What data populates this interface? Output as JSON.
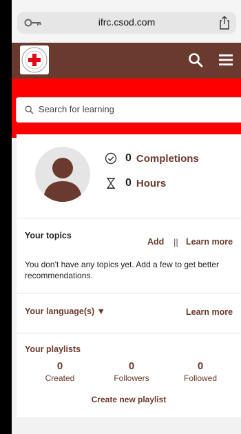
{
  "browser": {
    "url": "ifrc.csod.com"
  },
  "search": {
    "placeholder": "Search for learning"
  },
  "stats": {
    "completions": {
      "value": "0",
      "label": "Completions"
    },
    "hours": {
      "value": "0",
      "label": "Hours"
    }
  },
  "topics": {
    "title": "Your topics",
    "add_label": "Add",
    "separator": "||",
    "learn_more_label": "Learn more",
    "empty_text": "You don't have any topics yet. Add a few to get better recommendations."
  },
  "languages": {
    "title": "Your language(s) ▼",
    "learn_more_label": "Learn more"
  },
  "playlists": {
    "title": "Your playlists",
    "created": {
      "value": "0",
      "label": "Created"
    },
    "followers": {
      "value": "0",
      "label": "Followers"
    },
    "followed": {
      "value": "0",
      "label": "Followed"
    },
    "create_label": "Create new playlist"
  },
  "colors": {
    "brand": "#6b3a2e",
    "banner": "#ff0000"
  },
  "icons": [
    "key-icon",
    "share-icon",
    "ifrc-logo",
    "search-icon",
    "hamburger-menu-icon",
    "check-circle-icon",
    "hourglass-icon",
    "user-avatar"
  ]
}
